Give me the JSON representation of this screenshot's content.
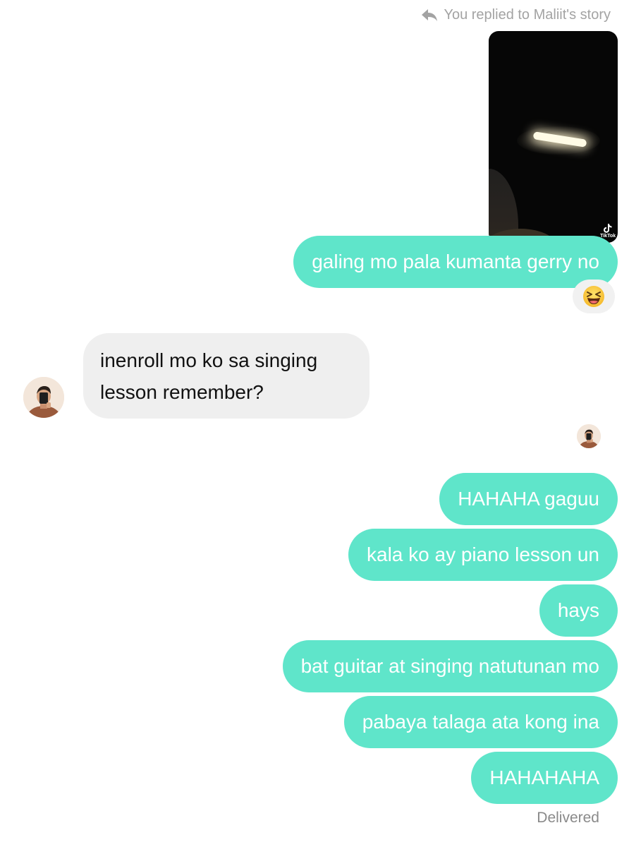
{
  "story": {
    "reply_text": "You replied to Maliit's story",
    "tiktok_label": "TikTok"
  },
  "messages": {
    "m1": "galing mo pala kumanta gerry no",
    "reaction": "😆",
    "m2": "inenroll mo ko sa singing lesson remember?",
    "m3": "HAHAHA gaguu",
    "m4": "kala ko ay piano lesson un",
    "m5": "hays",
    "m6": "bat guitar at singing natutunan mo",
    "m7": "pabaya talaga ata kong ina",
    "m8": "HAHAHAHA"
  },
  "status": "Delivered",
  "colors": {
    "sent_bubble": "#5fe5ca",
    "received_bubble": "#efefef",
    "meta_text": "#a3a3a3"
  },
  "icons": {
    "reply": "reply-arrow-icon",
    "reaction": "laughing-face-emoji",
    "tiktok": "tiktok-logo-icon"
  }
}
